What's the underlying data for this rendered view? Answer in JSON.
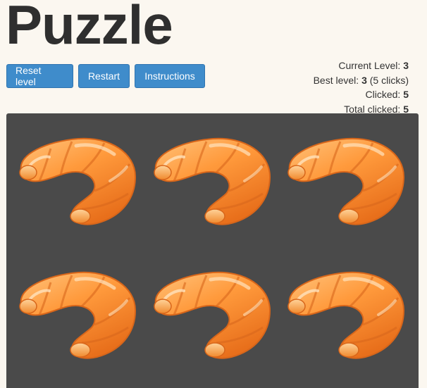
{
  "title": "Puzzle",
  "buttons": {
    "reset": "Reset level",
    "restart": "Restart",
    "instructions": "Instructions"
  },
  "stats": {
    "current_level_label": "Current Level:",
    "current_level": "3",
    "best_level_label": "Best level:",
    "best_level": "3",
    "best_level_clicks": "(5 clicks)",
    "clicked_label": "Clicked:",
    "clicked": "5",
    "total_clicked_label": "Total clicked:",
    "total_clicked": "5"
  },
  "board": {
    "tile_icon": "croissant-icon",
    "tile_count": 6,
    "colors": {
      "board": "#4a4a4a",
      "button": "#3f8ccb"
    }
  }
}
